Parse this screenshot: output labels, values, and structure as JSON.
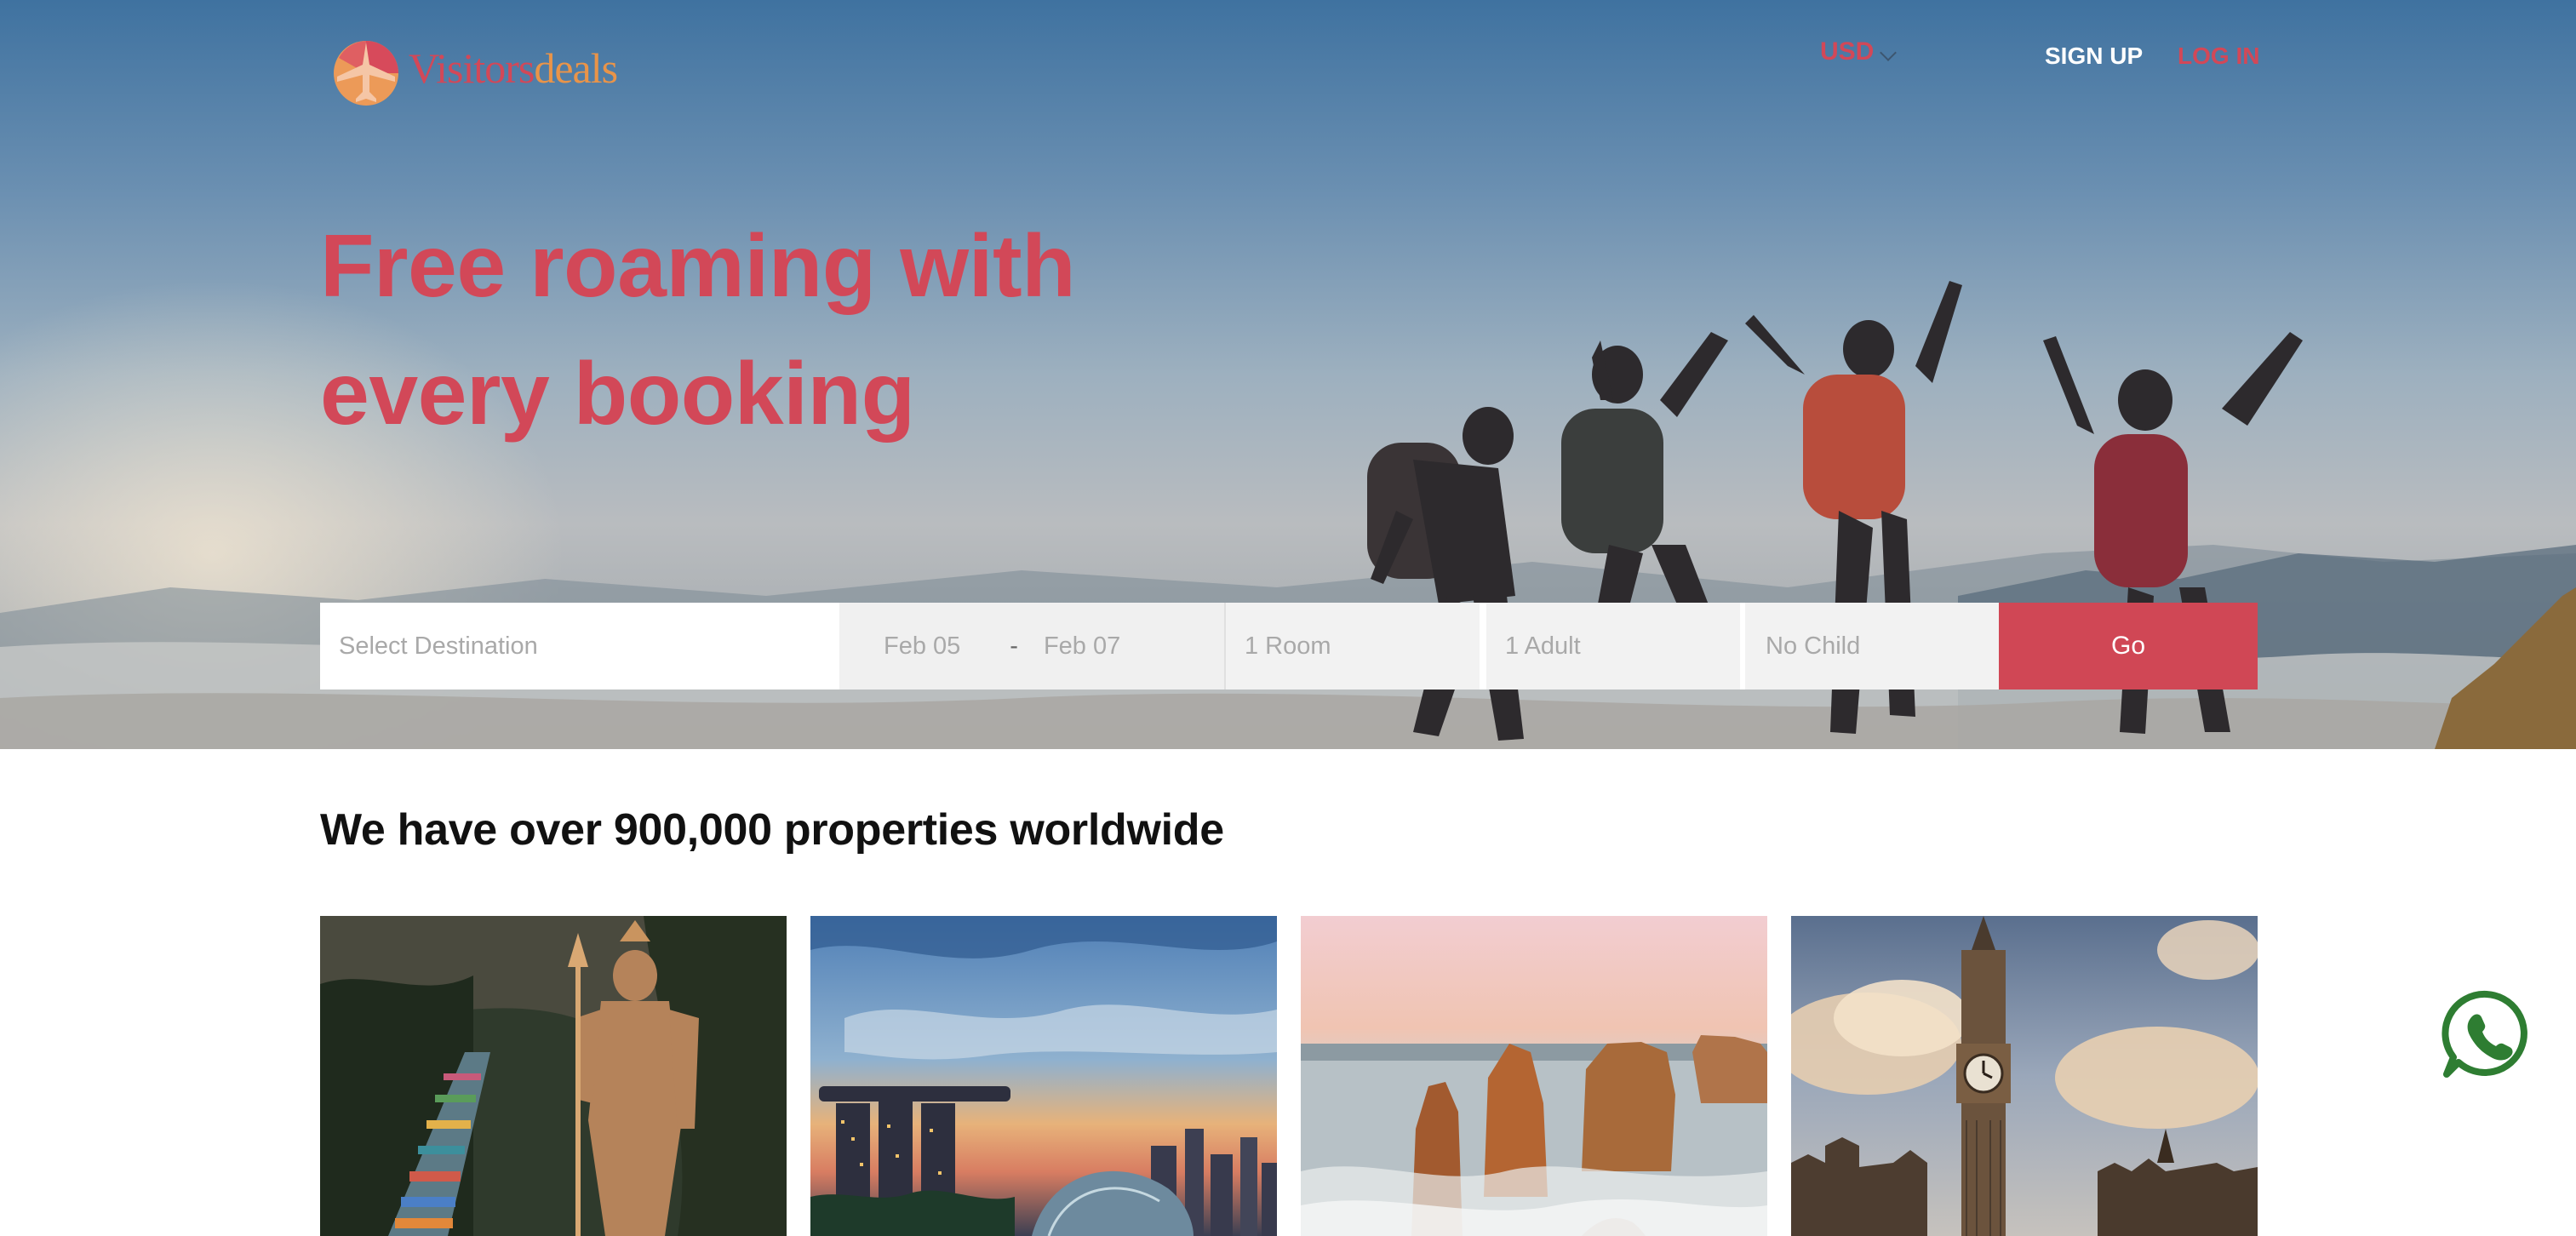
{
  "header": {
    "logo_text_primary": "Visitors",
    "logo_text_secondary": "deals",
    "currency": "USD",
    "signup_label": "SIGN UP",
    "login_label": "LOG IN"
  },
  "hero": {
    "headline_line1": "Free roaming with",
    "headline_line2": "every booking"
  },
  "search": {
    "destination_placeholder": "Select Destination",
    "checkin": "Feb 05",
    "date_separator": "-",
    "checkout": "Feb 07",
    "rooms": "1 Room",
    "adults": "1 Adult",
    "children": "No Child",
    "go_label": "Go"
  },
  "section": {
    "title": "We have over 900,000 properties worldwide"
  },
  "destinations": [
    {
      "icon": "statue-temple-image"
    },
    {
      "icon": "city-skyline-image"
    },
    {
      "icon": "coastal-rocks-image"
    },
    {
      "icon": "clock-tower-image"
    }
  ],
  "colors": {
    "brand_red": "#d24858",
    "brand_orange": "#e99449",
    "go_button": "#d04755",
    "whatsapp_green": "#2e7d32"
  }
}
